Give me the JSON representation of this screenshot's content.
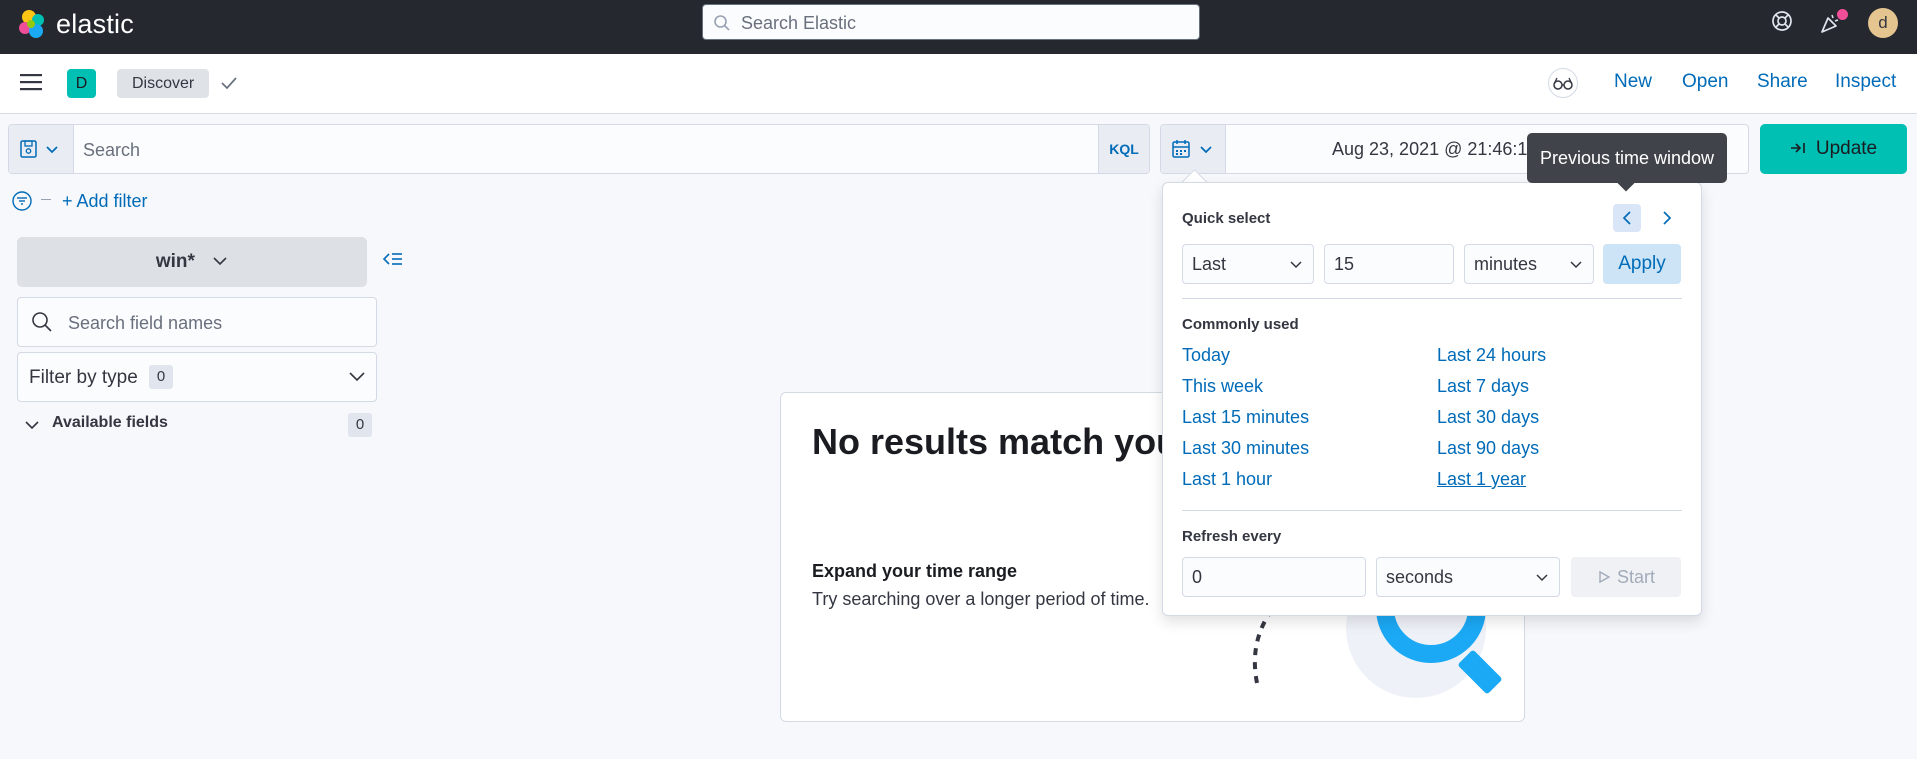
{
  "header": {
    "logo_text": "elastic",
    "search_placeholder": "Search Elastic",
    "avatar_initial": "d",
    "icons": [
      "help-icon",
      "newsfeed-icon"
    ]
  },
  "navbar": {
    "space_initial": "D",
    "breadcrumb": "Discover",
    "links": {
      "new": "New",
      "open": "Open",
      "share": "Share",
      "inspect": "Inspect"
    }
  },
  "query": {
    "placeholder": "Search",
    "language": "KQL",
    "date_start": "Aug 23, 2021 @ 21:46:1",
    "update_label": "Update"
  },
  "filter": {
    "add_label": "+ Add filter"
  },
  "sidebar": {
    "index_pattern": "win*",
    "field_search_placeholder": "Search field names",
    "filter_by_type_label": "Filter by type",
    "filter_by_type_count": "0",
    "available_fields_label": "Available fields",
    "available_fields_count": "0"
  },
  "results": {
    "title": "No results match your",
    "expand_heading": "Expand your time range",
    "expand_text": "Try searching over a longer period of time."
  },
  "tooltip": {
    "text": "Previous time window"
  },
  "popover": {
    "quick_select_label": "Quick select",
    "tense": "Last",
    "value": "15",
    "unit": "minutes",
    "apply_label": "Apply",
    "commonly_used_label": "Commonly used",
    "commonly_used_left": [
      "Today",
      "This week",
      "Last 15 minutes",
      "Last 30 minutes",
      "Last 1 hour"
    ],
    "commonly_used_right": [
      "Last 24 hours",
      "Last 7 days",
      "Last 30 days",
      "Last 90 days",
      "Last 1 year"
    ],
    "refresh_label": "Refresh every",
    "refresh_value": "0",
    "refresh_unit": "seconds",
    "start_label": "Start"
  },
  "colors": {
    "accent": "#00bfb3",
    "link": "#006bb8",
    "header_bg": "#25282f"
  }
}
